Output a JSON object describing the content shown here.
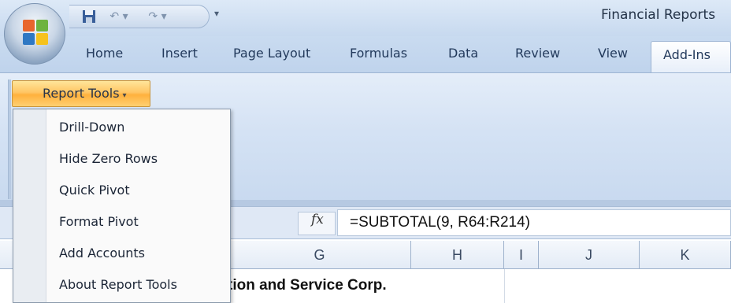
{
  "window": {
    "title": "Financial Reports"
  },
  "quick_access": {
    "save_icon": "save-icon",
    "undo_icon": "undo-icon",
    "redo_icon": "redo-icon",
    "customize_icon": "customize-qat-icon"
  },
  "tabs": [
    {
      "label": "Home"
    },
    {
      "label": "Insert"
    },
    {
      "label": "Page Layout"
    },
    {
      "label": "Formulas"
    },
    {
      "label": "Data"
    },
    {
      "label": "Review"
    },
    {
      "label": "View"
    },
    {
      "label": "Add-Ins",
      "active": true
    }
  ],
  "ribbon": {
    "report_tools_label": "Report Tools"
  },
  "menu": {
    "items": [
      {
        "label": "Drill-Down"
      },
      {
        "label": "Hide Zero Rows"
      },
      {
        "label": "Quick Pivot"
      },
      {
        "label": "Format Pivot"
      },
      {
        "label": "Add Accounts"
      },
      {
        "label": "About Report Tools"
      }
    ]
  },
  "formula_bar": {
    "fx_label": "fx",
    "formula": "=SUBTOTAL(9, R64:R214)"
  },
  "columns": [
    "G",
    "H",
    "I",
    "J",
    "K"
  ],
  "grid": {
    "visible_text": "tion and Service Corp."
  },
  "colors": {
    "accent": "#ffc564",
    "ribbon": "#d4e2f4",
    "menu_gutter": "#e9edf2"
  }
}
